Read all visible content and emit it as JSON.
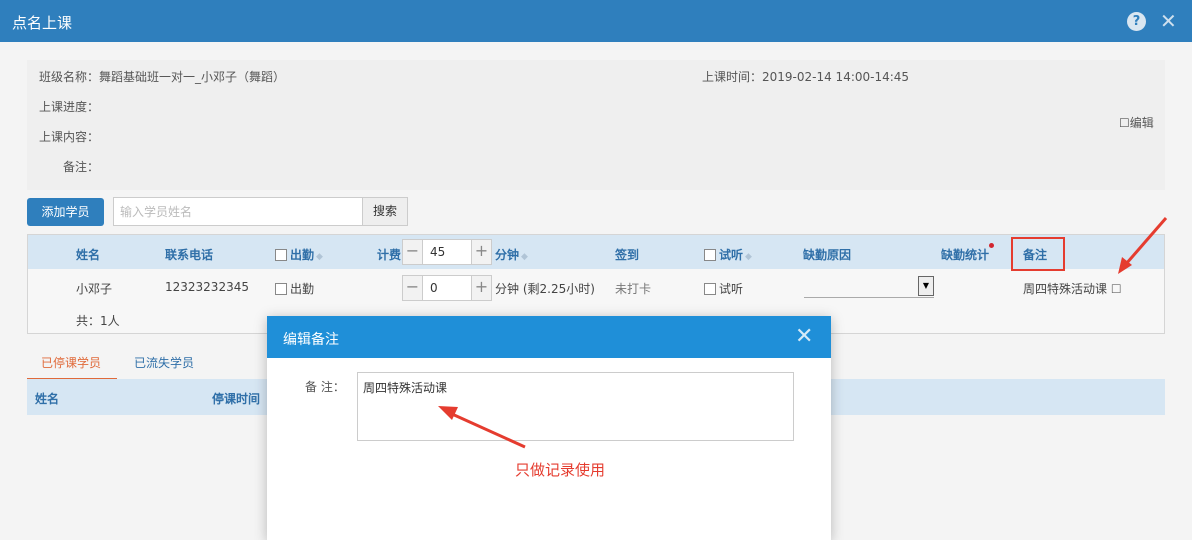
{
  "window": {
    "title": "点名上课"
  },
  "info": {
    "class_name": "班级名称：舞蹈基础班一对一_小邓子（舞蹈）",
    "class_time": "上课时间：2019-02-14   14:00-14:45",
    "progress_label": "上课进度：",
    "content_label": "上课内容：",
    "note_label": "备注：",
    "edit_label": "编辑"
  },
  "toolbar": {
    "add_student": "添加学员",
    "search_placeholder": "输入学员姓名",
    "search_button": "搜索"
  },
  "table": {
    "headers": {
      "name": "姓名",
      "phone": "联系电话",
      "attendance": "出勤",
      "charge": "计费",
      "minutes": "分钟",
      "sign": "签到",
      "trial": "试听",
      "absence_reason": "缺勤原因",
      "absence_stats": "缺勤统计",
      "note": "备注"
    },
    "header_charge_value": "45",
    "rows": [
      {
        "name": "小邓子",
        "phone": "12323232345",
        "attendance": "出勤",
        "charge_value": "0",
        "minutes": "分钟 (剩2.25小时)",
        "sign": "未打卡",
        "trial": "试听",
        "note": "周四特殊活动课"
      }
    ],
    "total": "共：1人"
  },
  "tabs": [
    {
      "label": "已停课学员"
    },
    {
      "label": "已流失学员"
    }
  ],
  "table2": {
    "headers": {
      "name": "姓名",
      "stop_time": "停课时间"
    }
  },
  "dialog": {
    "title": "编辑备注",
    "note_label": "备  注：",
    "note_value": "周四特殊活动课"
  },
  "annotation": {
    "text": "只做记录使用"
  },
  "colors": {
    "titlebar": "#2f7fbd",
    "dialog_header": "#1f8fd8",
    "highlight_red": "#e53c2f",
    "active_tab": "#e06a3a"
  }
}
